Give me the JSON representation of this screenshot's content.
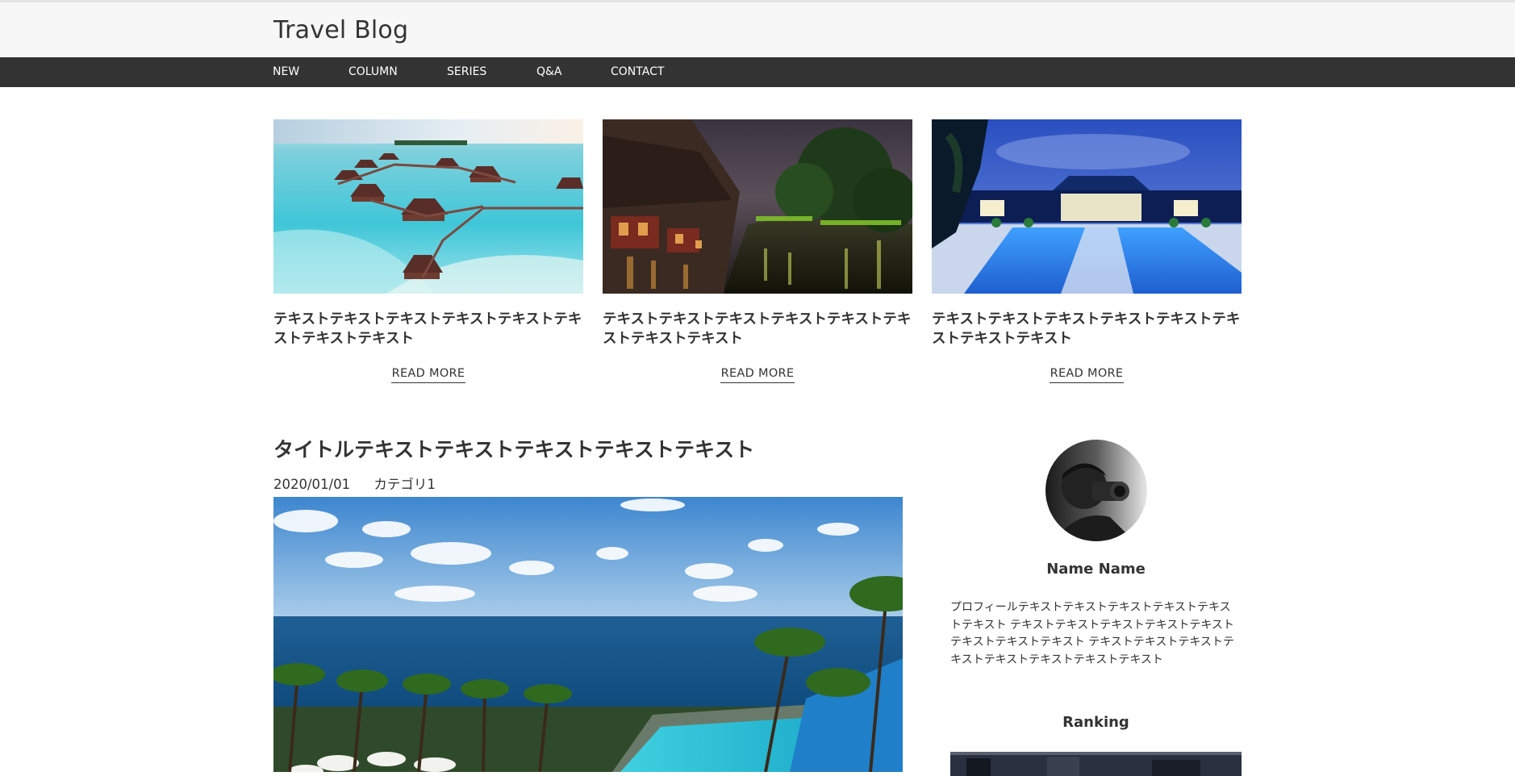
{
  "header": {
    "logo": "Travel Blog"
  },
  "nav": {
    "items": [
      "NEW",
      "COLUMN",
      "SERIES",
      "Q&A",
      "CONTACT"
    ]
  },
  "featured": [
    {
      "title": "テキストテキストテキストテキストテキストテキストテキストテキスト",
      "read_more": "READ MORE"
    },
    {
      "title": "テキストテキストテキストテキストテキストテキストテキストテキスト",
      "read_more": "READ MORE"
    },
    {
      "title": "テキストテキストテキストテキストテキストテキストテキストテキスト",
      "read_more": "READ MORE"
    }
  ],
  "post": {
    "title": "タイトルテキストテキストテキストテキストテキスト",
    "date": "2020/01/01",
    "category": "カテゴリ1"
  },
  "sidebar": {
    "profile_name": "Name Name",
    "profile_text": "プロフィールテキストテキストテキストテキストテキストテキスト テキストテキストテキストテキストテキストテキストテキストテキスト テキストテキストテキストテキストテキストテキストテキストテキスト",
    "ranking_title": "Ranking"
  },
  "colors": {
    "header_bg": "#f7f7f7",
    "nav_bg": "#333333",
    "text": "#333333"
  }
}
